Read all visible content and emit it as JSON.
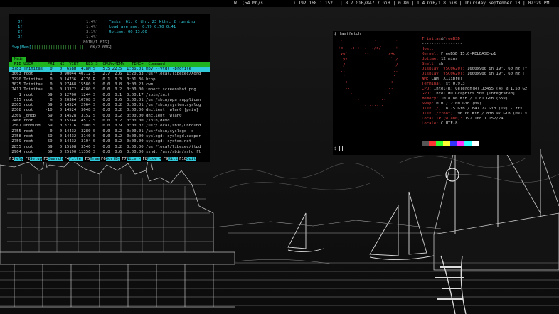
{
  "statusbar": {
    "wifi": "W: (54 Mb/s",
    "ip": ") 192.168.1.152",
    "mem": "| 8.7 GiB/847.7 GiB | 0.80 | 1.4 GiB/1.8 GiB | Thursday September 10 | 02:29 PM"
  },
  "htop": {
    "cpus": [
      {
        "label": "0[",
        "pct": "1.4%]"
      },
      {
        "label": "1[",
        "pct": "1.4%]"
      },
      {
        "label": "2[",
        "pct": "3.1%]"
      },
      {
        "label": "3[",
        "pct": "1.4%]"
      }
    ],
    "mem_label": "Mem[",
    "mem_bar": "|||||||||||||||||||||||",
    "mem_value": "801M/1.81G]",
    "swp_label": "Swp[",
    "swp_value": "0K/2.00G]",
    "tasks": "Tasks: 61, 0 thr, 23 kthr; 2 running",
    "load": "Load average: 0.79 0.70 0.41",
    "uptime": "Uptime: 00:13:00",
    "tab": "Main",
    "columns": "  PID USER      PRI  NI  VIRT   RES S  CPU%▽MEM%   TIME+  Command",
    "processes": [
      " 3783 Trinitas   0   0  658M  418M S   5.5 22.5  1:36.01 mpv --ytdl -profile",
      " 3063 root       1   0 90044 40712 S   2.7  2.6  1:20.83 /usr/local/libexec/Xorg",
      " 3290 Trinitas   0   0 14736  4176 R   0.1  0.3  0:01.36 htop",
      " 3075 Trinitas   0   0 27468 15580 S   0.0  0.8  0:00.23 cwm",
      " 7411 Trinitas   0   0 13372  4280 S   0.0  0.2  0:00.00 import screenshot.png",
      "    1 root      59   0 12700  1244 S   0.0  0.1  0:00.17 /sbin/init",
      "  515 root       0   0 20364 10708 S   0.0  0.6  0:00.01 /usr/sbin/wpa_supplican",
      " 2305 root      59   0 14524  2964 S   0.0  0.2  0:00.01 /usr/sbin/system.syslog",
      " 2308 root     -10   0 14524  3048 S   0.0  0.2  0:00.00 dhclient: wlan0 [priv]",
      " 2369 _dhcp     59   0 14528  3152 S   0.0  0.2  0:00.00 dhclient: wlan0",
      " 2466 root       0   0 15744  4512 S   0.0  0.2  0:00.00 /sbin/devd",
      " 2567 unbound   59   0 37776 17900 S   0.0  0.9  0:00.02 /usr/local/sbin/unbound",
      " 2755 root       0   0 14432  3280 S   0.0  0.2  0:00.01 /usr/sbin/syslogd -s",
      " 2758 root      59   0 14432  3140 S   0.0  0.2  0:00.00 syslogd: syslogd.casper",
      " 2759 root      59   0 14432  3104 S   0.0  0.2  0:00.00 syslogd: system.net",
      " 2855 root      59   0 15108  3540 S   0.0  0.2  0:00.00 /usr/local/libexec/ftpd",
      " 2964 root      59   0 25190 11356 S   0.0  0.6  0:00.00 sshd: /usr/sbin/sshd [l"
    ],
    "fkeys": [
      {
        "key": "F1",
        "label": "Help"
      },
      {
        "key": "F2",
        "label": "Setup"
      },
      {
        "key": "F3",
        "label": "Search"
      },
      {
        "key": "F4",
        "label": "Filter"
      },
      {
        "key": "F5",
        "label": "Tree"
      },
      {
        "key": "F6",
        "label": "SortBy"
      },
      {
        "key": "F7",
        "label": "Nice -"
      },
      {
        "key": "F8",
        "label": "Nice +"
      },
      {
        "key": "F9",
        "label": "Kill"
      },
      {
        "key": "F10",
        "label": "Quit"
      }
    ]
  },
  "fastfetch": {
    "command": "$ fastfetch",
    "prompt": "$ ",
    "user": "Trinitas",
    "at": "@",
    "host": "FreeBSD",
    "separator": "-----------------",
    "logo": [
      "  ` ......      ` .......` ",
      " +o   .:::::.  ./o/     -+ ",
      "  yo`      .--        /+o  ",
      "   y/                ..`./  ",
      "   /                     /  ",
      "  .:                    :.  ",
      "   :                    :   ",
      "    :                  :    ",
      "    .:                .:    ",
      "      -               -     ",
      "        ..         ..       ",
      "          ..........        "
    ],
    "info": [
      {
        "key": "Host",
        "value": ""
      },
      {
        "key": "Kernel",
        "value": "FreeBSD 15.0-RELEASE-p1"
      },
      {
        "key": "Uptime",
        "value": "12 mins"
      },
      {
        "key": "Shell",
        "value": "sh"
      },
      {
        "key": "Display (VSC0620)",
        "value": "1600x900 in 19\", 60 Hz [*"
      },
      {
        "key": "Display (VSC0620)",
        "value": "1600x900 in 19\", 60 Hz []"
      },
      {
        "key": "WM",
        "value": "CWM (X11ibre)"
      },
      {
        "key": "Terminal",
        "value": "st 0.9.3"
      },
      {
        "key": "CPU",
        "value": "Intel(R) Celeron(R) J3455 (4) @ 1.50 Gz"
      },
      {
        "key": "GPU",
        "value": "Intel HD Graphics 500 [Integrated]"
      },
      {
        "key": "Memory",
        "value": "1018.86 MiB / 1.81 GiB (55%)"
      },
      {
        "key": "Swap",
        "value": "0 B / 2.00 GiB (0%)"
      },
      {
        "key": "Disk (/)",
        "value": "8.75 GiB / 847.72 GiB (1%) - zfs"
      },
      {
        "key": "Disk (/zroot)",
        "value": "96.00 KiB / 838.97 GiB (0%) s"
      },
      {
        "key": "Local IP (wlan0)",
        "value": "192.168.1.152/24"
      },
      {
        "key": "Locale",
        "value": "C.UTF-8"
      }
    ],
    "palette": [
      "#555555",
      "#ff3333",
      "#33ff33",
      "#ffff33",
      "#3333ff",
      "#ff33ff",
      "#33ffff",
      "#ffffff"
    ]
  },
  "colors": {
    "accent_cyan": "#2fc9d9",
    "accent_green": "#1fb31f",
    "freebsd_red": "#e04040"
  }
}
